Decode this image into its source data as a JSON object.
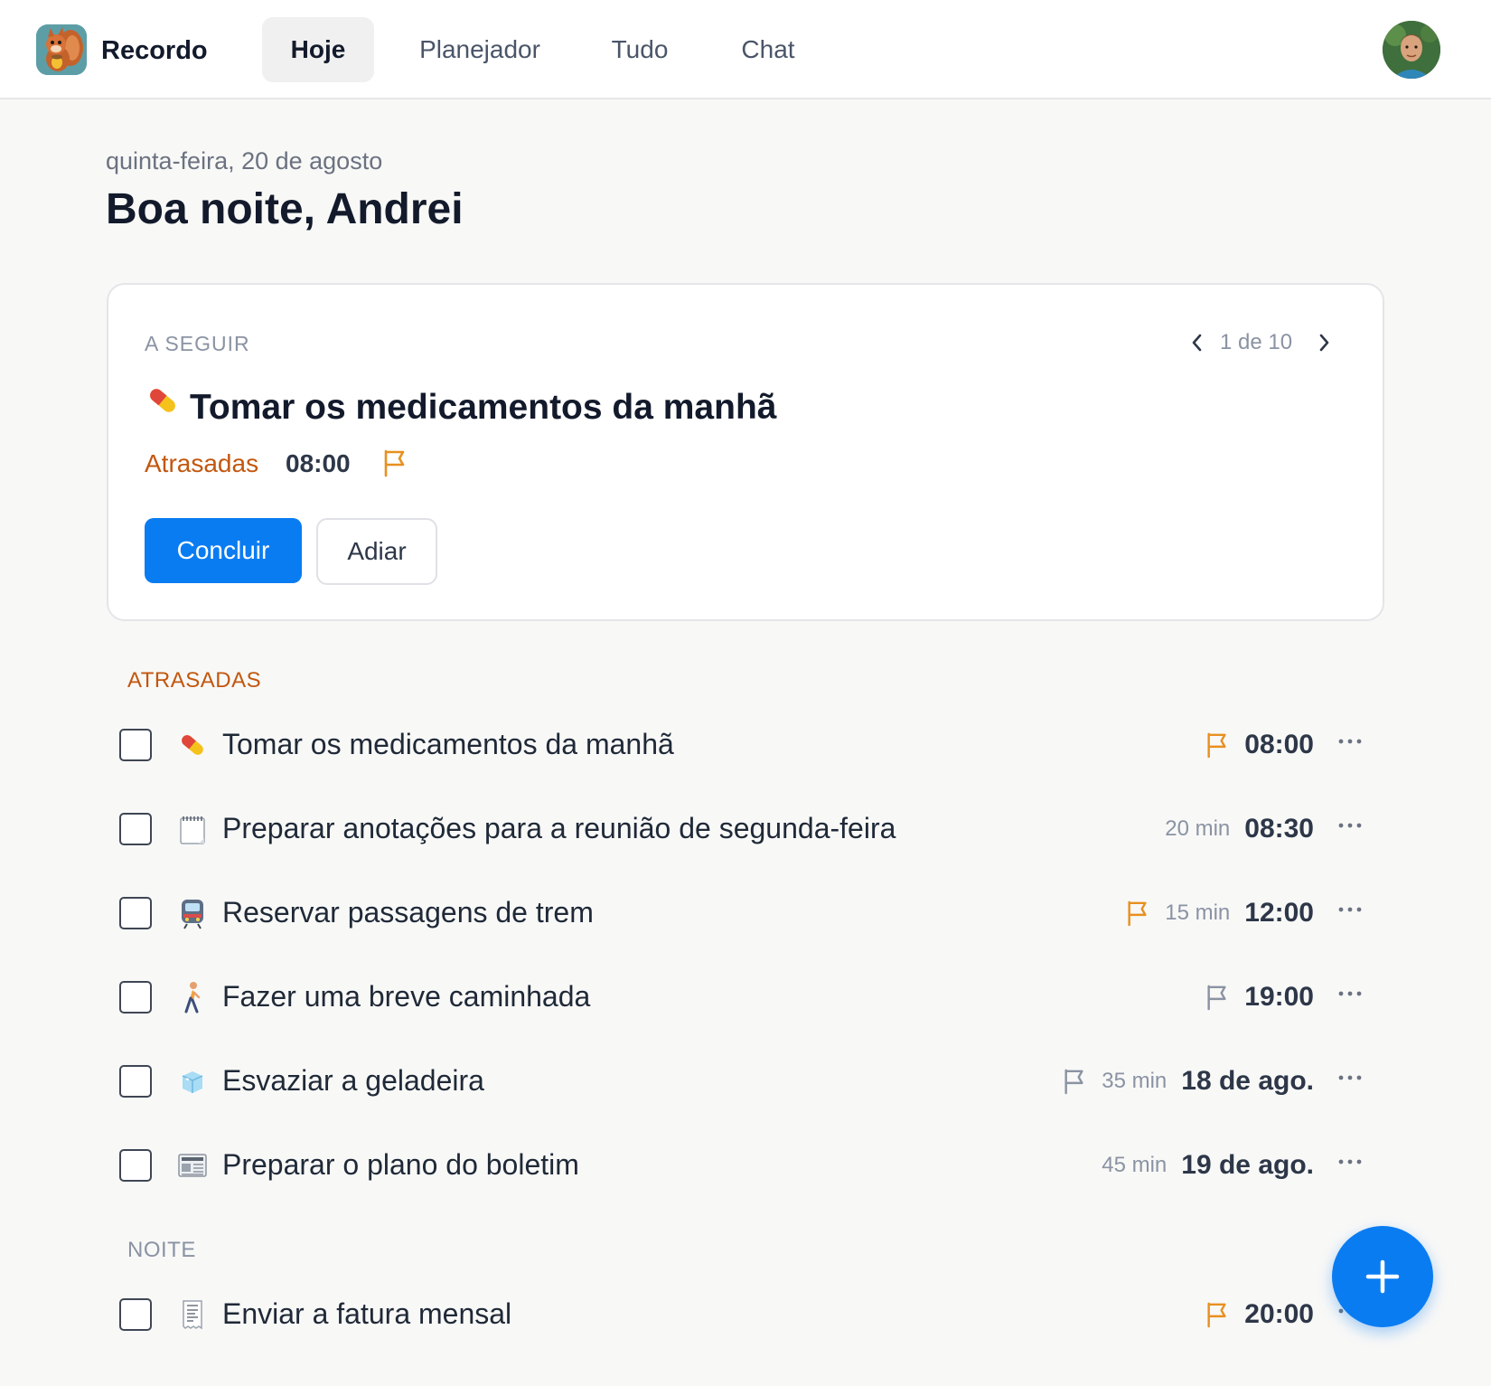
{
  "app": {
    "name": "Recordo"
  },
  "nav": {
    "tabs": [
      {
        "label": "Hoje",
        "active": true
      },
      {
        "label": "Planejador",
        "active": false
      },
      {
        "label": "Tudo",
        "active": false
      },
      {
        "label": "Chat",
        "active": false
      }
    ]
  },
  "header": {
    "date": "quinta-feira, 20 de agosto",
    "greeting": "Boa noite, Andrei"
  },
  "next_card": {
    "label": "A SEGUIR",
    "pager": "1 de 10",
    "prev_icon": "chevron-left-icon",
    "next_icon": "chevron-right-icon",
    "emoji": "pill",
    "title": "Tomar os medicamentos da manhã",
    "status": "Atrasadas",
    "time": "08:00",
    "flag_color": "#e8901f",
    "primary_button": "Concluir",
    "secondary_button": "Adiar"
  },
  "sections": [
    {
      "heading": "ATRASADAS",
      "tasks": [
        {
          "emoji": "pill",
          "title": "Tomar os medicamentos da manhã",
          "flag": "orange",
          "duration": "",
          "time": "08:00"
        },
        {
          "emoji": "spiral-notepad",
          "title": "Preparar anotações para a reunião de segunda-feira",
          "flag": "none",
          "duration": "20 min",
          "time": "08:30"
        },
        {
          "emoji": "train",
          "title": "Reservar passagens de trem",
          "flag": "orange",
          "duration": "15 min",
          "time": "12:00"
        },
        {
          "emoji": "person-walking",
          "title": "Fazer uma breve caminhada",
          "flag": "gray",
          "duration": "",
          "time": "19:00"
        },
        {
          "emoji": "ice-cube",
          "title": "Esvaziar a geladeira",
          "flag": "gray",
          "duration": "35 min",
          "time": "18 de ago."
        },
        {
          "emoji": "newspaper",
          "title": "Preparar o plano do boletim",
          "flag": "none",
          "duration": "45 min",
          "time": "19 de ago."
        }
      ]
    },
    {
      "heading": "NOITE",
      "tasks": [
        {
          "emoji": "receipt",
          "title": "Enviar a fatura mensal",
          "flag": "orange",
          "duration": "",
          "time": "20:00"
        }
      ]
    }
  ],
  "colors": {
    "accent": "#0a7cf2",
    "overdue": "#c2570f",
    "flag_orange": "#e8901f",
    "flag_gray": "#8a93a3",
    "background": "#f8f8f7"
  },
  "fab": {
    "icon": "plus-icon"
  }
}
